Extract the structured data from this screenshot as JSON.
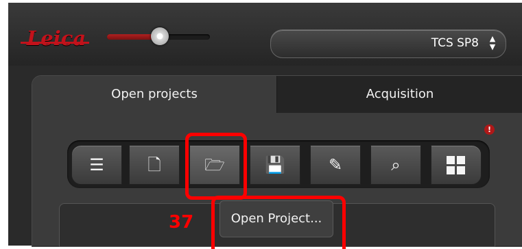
{
  "header": {
    "logo_text": "Leica",
    "device": "TCS SP8",
    "device_arrows": "▲▼"
  },
  "tabs": [
    {
      "label": "Open projects",
      "active": true
    },
    {
      "label": "Acquisition",
      "active": false
    }
  ],
  "toolbar": {
    "buttons": [
      {
        "icon": "export-list-icon",
        "glyph": "☰"
      },
      {
        "icon": "new-document-icon",
        "glyph": "🗋"
      },
      {
        "icon": "open-folder-icon",
        "glyph": "🗁"
      },
      {
        "icon": "save-icon",
        "glyph": "💾"
      },
      {
        "icon": "edit-document-icon",
        "glyph": "✎"
      },
      {
        "icon": "search-document-icon",
        "glyph": "⌕"
      },
      {
        "icon": "grid-layout-icon",
        "glyph": ""
      }
    ]
  },
  "info_badge": "!",
  "annotation": {
    "step_number": "37",
    "tooltip": "Open Project..."
  },
  "colors": {
    "accent": "#c2121b",
    "highlight": "#ff0000",
    "panel": "#3b3b3b"
  }
}
